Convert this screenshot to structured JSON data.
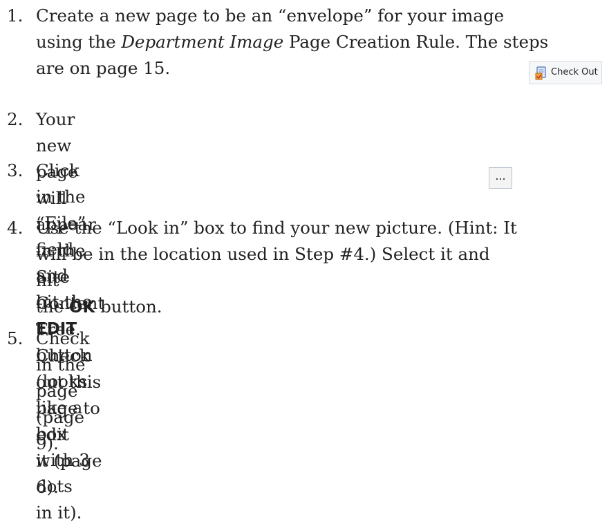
{
  "steps": [
    {
      "num": "1.",
      "lines": [
        [
          "Create a new page to be an “envelope” for your image"
        ],
        [
          "using the ",
          {
            "i": "Department Image"
          },
          " Page Creation Rule. The steps"
        ],
        [
          "are on page 15."
        ]
      ]
    },
    {
      "num": "2.",
      "lines": [
        [
          "Your new page will appear in the Site"
        ],
        [
          "Content Tree. Check out this page to edit"
        ],
        [
          "it  (page 6)."
        ]
      ]
    },
    {
      "num": "3.",
      "lines": [
        [
          "Click in the “File” field and hit the ",
          {
            "b": "EDIT"
          },
          " button"
        ],
        [
          "(looks like a box with 3 dots in it)."
        ]
      ]
    },
    {
      "num": "4.",
      "lines": [
        [
          "Use the “Look in” box to find your new picture. (Hint: It"
        ],
        [
          "will be in the location used in Step #4.) Select it and hit"
        ],
        [
          "the ",
          {
            "b": "OK"
          },
          " button."
        ]
      ]
    },
    {
      "num": "5.",
      "lines": [
        [
          "Check in the page (page 9)."
        ]
      ]
    }
  ],
  "checkout_button": {
    "label": "Check Out",
    "icon": "checkout-icon"
  },
  "edit_button": {
    "label": "...",
    "icon": "ellipsis"
  }
}
